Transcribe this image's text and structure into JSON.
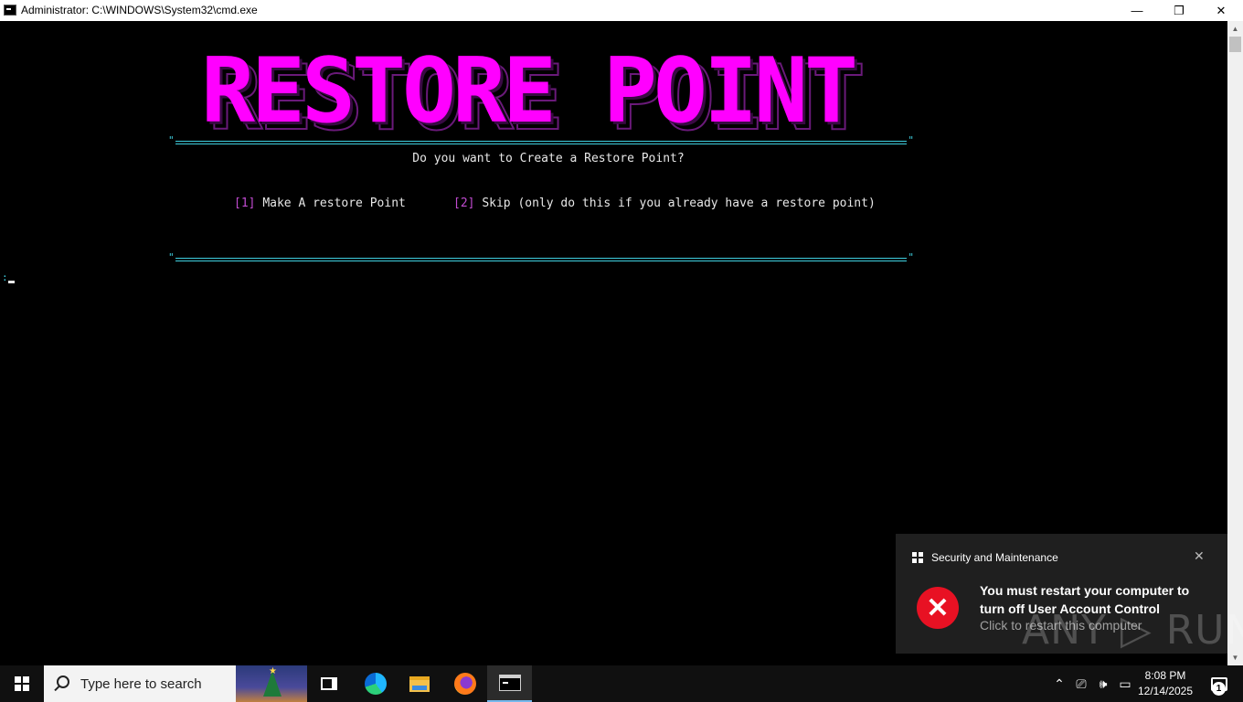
{
  "window": {
    "title": "Administrator: C:\\WINDOWS\\System32\\cmd.exe",
    "minimize_glyph": "—",
    "maximize_glyph": "❐",
    "close_glyph": "✕"
  },
  "console": {
    "banner_text": "RESTORE POINT",
    "rule_quote_open": "\"",
    "rule_quote_close": "\"",
    "prompt": "Do you want to Create a Restore Point?",
    "options": [
      {
        "key": "[1]",
        "label": "Make A restore Point"
      },
      {
        "key": "[2]",
        "label": "Skip (only do this if you already have a restore point)"
      }
    ],
    "input_prefix": ":"
  },
  "colors": {
    "banner": "#ff00ff",
    "rule": "#3fd0e0",
    "option_key": "#c04bd0",
    "console_text": "#e8e8e8",
    "error_red": "#e81123"
  },
  "toast": {
    "app_name": "Security and Maintenance",
    "close_glyph": "✕",
    "error_glyph": "✕",
    "headline": "You must restart your computer to turn off User Account Control",
    "subtext": "Click to restart this computer",
    "watermark": "ANY ▷ RUN"
  },
  "taskbar": {
    "search_placeholder": "Type here to search",
    "icons": [
      "windows-icon",
      "search-icon",
      "task-view-icon",
      "edge-icon",
      "file-explorer-icon",
      "firefox-icon",
      "cmd-icon"
    ],
    "tray": {
      "chevron_glyph": "⌃",
      "meet_glyph": "⎚",
      "volume_glyph": "🕪",
      "network_glyph": "▭"
    },
    "time": "8:08 PM",
    "date": "12/14/2025",
    "notification_count": "1"
  }
}
